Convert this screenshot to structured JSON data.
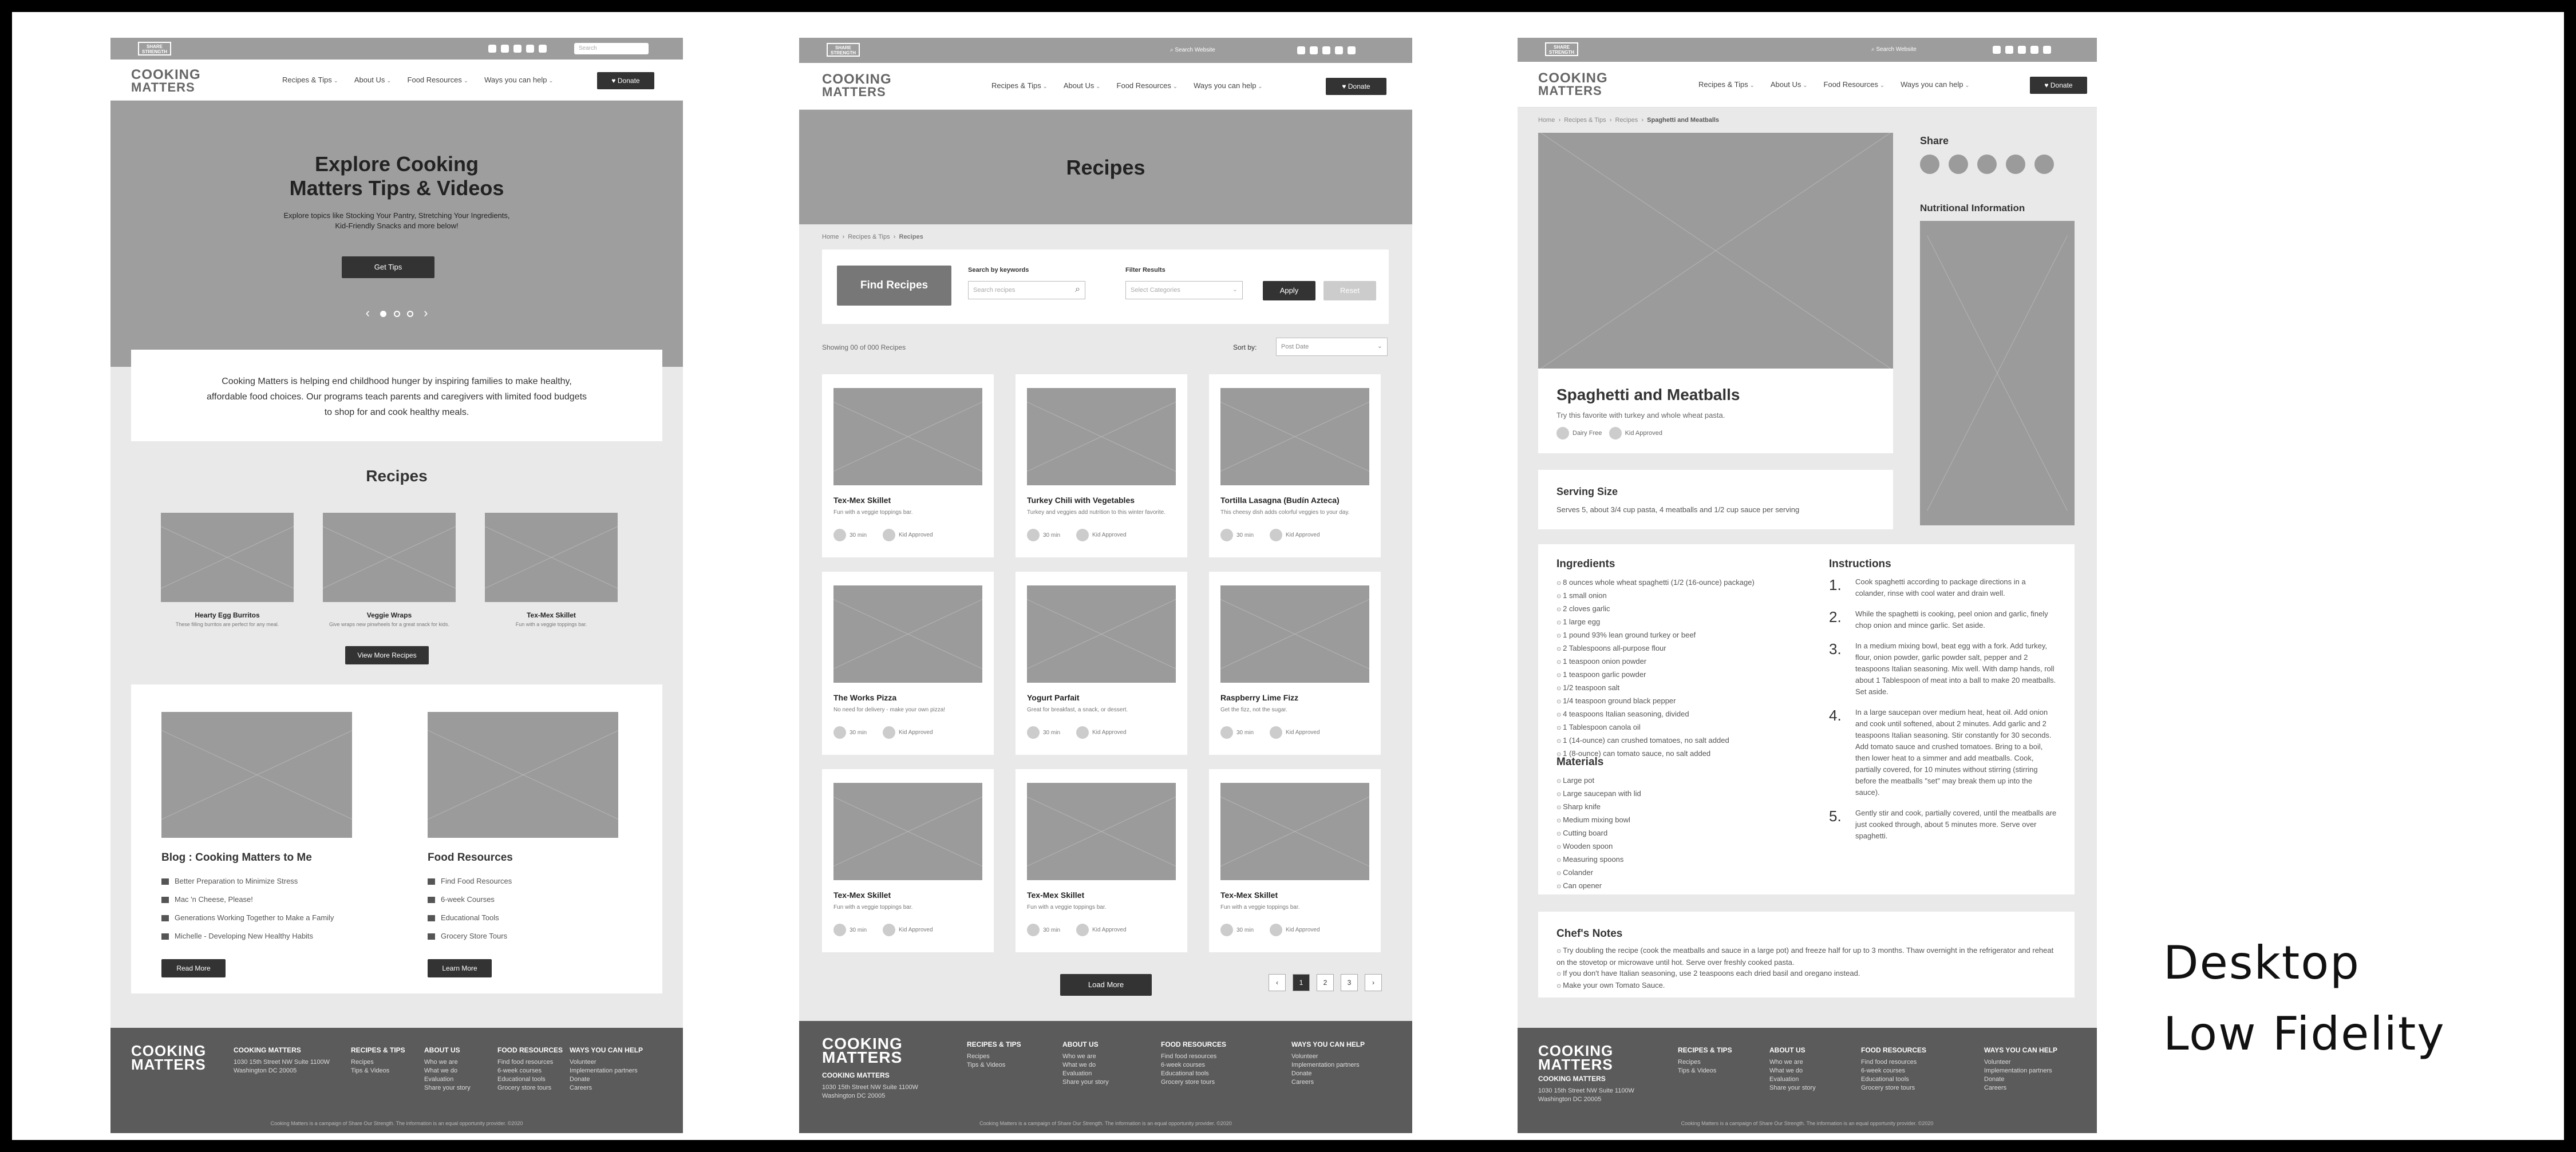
{
  "p1": {
    "topsearch": "Search",
    "logo1": "COOKING",
    "logo2": "MATTERS",
    "nav": [
      "Recipes & Tips",
      "About Us",
      "Food Resources",
      "Ways you can help"
    ],
    "donate": "Donate",
    "hero_title": [
      "Explore Cooking",
      "Matters Tips & Videos"
    ],
    "hero_sub": [
      "Explore topics like Stocking Your Pantry, Stretching Your Ingredients,",
      "Kid-Friendly Snacks and more below!"
    ],
    "hero_btn": "Get Tips",
    "mission": [
      "Cooking Matters is helping end childhood hunger by inspiring families to make healthy,",
      "affordable food choices. Our programs teach parents and caregivers with limited food budgets",
      "to shop for and cook healthy meals."
    ],
    "recipes_title": "Recipes",
    "recipes": [
      {
        "t": "Hearty Egg Burritos",
        "d": "These filling burritos are perfect for any meal."
      },
      {
        "t": "Veggie Wraps",
        "d": "Give wraps new pinwheels for a great snack for kids."
      },
      {
        "t": "Tex-Mex Skillet",
        "d": "Fun with a veggie toppings bar."
      }
    ],
    "recipes_btn": "View More Recipes",
    "blog_title": "Blog : Cooking Matters to Me",
    "blog_items": [
      "Better Preparation to Minimize Stress",
      "Mac 'n Cheese, Please!",
      "Generations Working Together to Make a Family",
      "Michelle - Developing New Healthy Habits"
    ],
    "blog_btn": "Read More",
    "food_title": "Food Resources",
    "food_items": [
      "Find Food Resources",
      "6-week Courses",
      "Educational Tools",
      "Grocery Store Tours"
    ],
    "food_btn": "Learn More",
    "footer_org": "COOKING MATTERS",
    "footer_addr": [
      "1030 15th Street NW Suite 1100W",
      "Washington DC 20005"
    ],
    "fcols": [
      {
        "h": "RECIPES & TIPS",
        "i": [
          "Recipes",
          "Tips & Videos"
        ]
      },
      {
        "h": "ABOUT US",
        "i": [
          "Who we are",
          "What we do",
          "Evaluation",
          "Share your story"
        ]
      },
      {
        "h": "FOOD RESOURCES",
        "i": [
          "Find food resources",
          "6-week courses",
          "Educational tools",
          "Grocery store tours"
        ]
      },
      {
        "h": "WAYS YOU CAN HELP",
        "i": [
          "Volunteer",
          "Implementation partners",
          "Donate",
          "Careers"
        ]
      }
    ],
    "copy": "Cooking Matters is a campaign of Share Our Strength. The information is an equal opportunity provider. ©2020"
  },
  "p2": {
    "topsearch": "Search Website",
    "page_title": "Recipes",
    "crumbs": [
      "Home",
      "Recipes & Tips",
      "Recipes"
    ],
    "find_title": "Find Recipes",
    "kw_label": "Search by keywords",
    "kw_ph": "Search recipes",
    "filter_label": "Filter Results",
    "filter_ph": "Select Categories",
    "apply": "Apply",
    "reset": "Reset",
    "showing": "Showing 00 of 000 Recipes",
    "sort_label": "Sort by:",
    "sort_val": "Post Date",
    "cards": [
      {
        "t": "Tex-Mex Skillet",
        "d": "Fun with a veggie toppings bar."
      },
      {
        "t": "Turkey Chili with Vegetables",
        "d": "Turkey and veggies add nutrition to this winter favorite."
      },
      {
        "t": "Tortilla Lasagna (Budín Azteca)",
        "d": "This cheesy dish adds colorful veggies to your day."
      },
      {
        "t": "The Works Pizza",
        "d": "No need for delivery - make your own pizza!"
      },
      {
        "t": "Yogurt Parfait",
        "d": "Great for breakfast, a snack, or dessert."
      },
      {
        "t": "Raspberry Lime Fizz",
        "d": "Get the fizz, not the sugar."
      },
      {
        "t": "Tex-Mex Skillet",
        "d": "Fun with a veggie toppings bar."
      },
      {
        "t": "Tex-Mex Skillet",
        "d": "Fun with a veggie toppings bar."
      },
      {
        "t": "Tex-Mex Skillet",
        "d": "Fun with a veggie toppings bar."
      }
    ],
    "time": "30 min",
    "kid": "Kid Approved",
    "load": "Load More",
    "pages": [
      "‹",
      "1",
      "2",
      "3",
      "›"
    ]
  },
  "p3": {
    "crumbs": [
      "Home",
      "Recipes & Tips",
      "Recipes",
      "Spaghetti and Meatballs"
    ],
    "share": "Share",
    "nutri": "Nutritional Information",
    "title": "Spaghetti and Meatballs",
    "sub": "Try this favorite with turkey and whole wheat pasta.",
    "badges": [
      "Dairy Free",
      "Kid Approved"
    ],
    "serving_title": "Serving Size",
    "serving": "Serves 5, about 3/4 cup pasta, 4 meatballs and 1/2 cup sauce per serving",
    "ing_title": "Ingredients",
    "ing": [
      "8 ounces whole wheat spaghetti (1/2 (16-ounce) package)",
      "1 small onion",
      "2 cloves garlic",
      "1 large egg",
      "1 pound 93% lean ground turkey or beef",
      "2 Tablespoons all-purpose flour",
      "1 teaspoon onion powder",
      "1 teaspoon garlic powder",
      "1/2 teaspoon salt",
      "1/4 teaspoon ground black pepper",
      "4 teaspoons Italian seasoning, divided",
      "1 Tablespoon canola oil",
      "1 (14-ounce) can crushed tomatoes, no salt added",
      "1 (8-ounce) can tomato sauce, no salt added"
    ],
    "mat_title": "Materials",
    "mat": [
      "Large pot",
      "Large saucepan with lid",
      "Sharp knife",
      "Medium mixing bowl",
      "Cutting board",
      "Wooden spoon",
      "Measuring spoons",
      "Colander",
      "Can opener"
    ],
    "ins_title": "Instructions",
    "ins": [
      "Cook spaghetti according to package directions in a colander, rinse with cool water and drain well.",
      "While the spaghetti is cooking, peel onion and garlic, finely chop onion and mince garlic. Set aside.",
      "In a medium mixing bowl, beat egg with a fork. Add turkey, flour, onion powder, garlic powder salt, pepper and 2 teaspoons Italian seasoning. Mix well. With damp hands, roll about 1 Tablespoon of meat into a ball to make 20 meatballs. Set aside.",
      "In a large saucepan over medium heat, heat oil. Add onion and cook until softened, about 2 minutes. Add garlic and 2 teaspoons Italian seasoning. Stir constantly for 30 seconds. Add tomato sauce and crushed tomatoes. Bring to a boil, then lower heat to a simmer and add meatballs. Cook, partially covered, for 10 minutes without stirring (stirring before the meatballs \"set\" may break them up into the sauce).",
      "Gently stir and cook, partially covered, until the meatballs are just cooked through, about 5 minutes more. Serve over spaghetti."
    ],
    "chef_title": "Chef's Notes",
    "chef": [
      "Try doubling the recipe (cook the meatballs and sauce in a large pot) and freeze half for up to 3 months. Thaw overnight in the refrigerator and reheat on the stovetop or microwave until hot. Serve over freshly cooked pasta.",
      "If you don't have Italian seasoning, use 2 teaspoons each dried basil and oregano instead.",
      "Make your own Tomato Sauce."
    ]
  },
  "caption": [
    "Desktop",
    "Low Fidelity"
  ]
}
